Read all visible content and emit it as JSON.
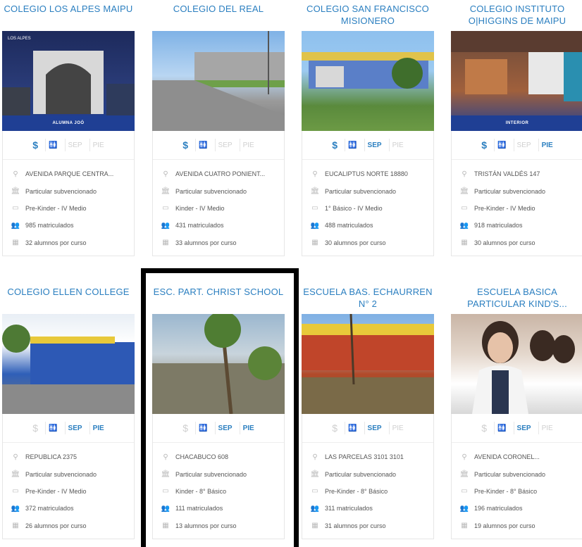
{
  "cards": [
    {
      "title": "COLEGIO LOS ALPES MAIPU",
      "banner": "ALUMNA JOÓ",
      "logo": "LOS ALPES",
      "badges": [
        {
          "label": "$",
          "on": true
        },
        {
          "label": "🚻",
          "on": true
        },
        {
          "label": "SEP",
          "on": false
        },
        {
          "label": "PIE",
          "on": false
        }
      ],
      "address": "AVENIDA PARQUE CENTRA...",
      "type": "Particular subvencionado",
      "levels": "Pre-Kinder - IV Medio",
      "enrolled": "985 matriculados",
      "per_course": "32 alumnos por curso"
    },
    {
      "title": "COLEGIO DEL REAL",
      "banner": "",
      "logo": "",
      "badges": [
        {
          "label": "$",
          "on": true
        },
        {
          "label": "🚻",
          "on": true
        },
        {
          "label": "SEP",
          "on": false
        },
        {
          "label": "PIE",
          "on": false
        }
      ],
      "address": "AVENIDA CUATRO PONIENT...",
      "type": "Particular subvencionado",
      "levels": "Kinder - IV Medio",
      "enrolled": "431 matriculados",
      "per_course": "33 alumnos por curso"
    },
    {
      "title": "COLEGIO SAN FRANCISCO MISIONERO",
      "banner": "",
      "logo": "",
      "badges": [
        {
          "label": "$",
          "on": true
        },
        {
          "label": "🚻",
          "on": true
        },
        {
          "label": "SEP",
          "on": true
        },
        {
          "label": "PIE",
          "on": false
        }
      ],
      "address": "EUCALIPTUS NORTE 18880",
      "type": "Particular subvencionado",
      "levels": "1° Básico - IV Medio",
      "enrolled": "488 matriculados",
      "per_course": "30 alumnos por curso"
    },
    {
      "title": "COLEGIO INSTITUTO O|HIGGINS DE MAIPU",
      "banner": "INTERIOR",
      "logo": "",
      "badges": [
        {
          "label": "$",
          "on": true
        },
        {
          "label": "🚻",
          "on": true
        },
        {
          "label": "SEP",
          "on": false
        },
        {
          "label": "PIE",
          "on": true
        }
      ],
      "address": "TRISTÁN VALDÉS 147",
      "type": "Particular subvencionado",
      "levels": "Pre-Kinder - IV Medio",
      "enrolled": "918 matriculados",
      "per_course": "30 alumnos por curso"
    },
    {
      "title": "COLEGIO ELLEN COLLEGE",
      "banner": "",
      "logo": "",
      "badges": [
        {
          "label": "$",
          "on": false
        },
        {
          "label": "🚻",
          "on": true
        },
        {
          "label": "SEP",
          "on": true
        },
        {
          "label": "PIE",
          "on": true
        }
      ],
      "address": "REPUBLICA 2375",
      "type": "Particular subvencionado",
      "levels": "Pre-Kinder - IV Medio",
      "enrolled": "372 matriculados",
      "per_course": "26 alumnos por curso"
    },
    {
      "title": "ESC. PART. CHRIST SCHOOL",
      "banner": "",
      "logo": "",
      "badges": [
        {
          "label": "$",
          "on": false
        },
        {
          "label": "🚻",
          "on": true
        },
        {
          "label": "SEP",
          "on": true
        },
        {
          "label": "PIE",
          "on": true
        }
      ],
      "address": "CHACABUCO 608",
      "type": "Particular subvencionado",
      "levels": "Kinder - 8° Básico",
      "enrolled": "111 matriculados",
      "per_course": "13 alumnos por curso"
    },
    {
      "title": "ESCUELA BAS. ECHAURREN N° 2",
      "banner": "",
      "logo": "",
      "badges": [
        {
          "label": "$",
          "on": false
        },
        {
          "label": "🚻",
          "on": true
        },
        {
          "label": "SEP",
          "on": true
        },
        {
          "label": "PIE",
          "on": false
        }
      ],
      "address": "LAS PARCELAS 3101 3101",
      "type": "Particular subvencionado",
      "levels": "Pre-Kinder - 8° Básico",
      "enrolled": "311 matriculados",
      "per_course": "31 alumnos por curso"
    },
    {
      "title": "ESCUELA BASICA PARTICULAR KIND'S...",
      "banner": "",
      "logo": "",
      "badges": [
        {
          "label": "$",
          "on": false
        },
        {
          "label": "🚻",
          "on": true
        },
        {
          "label": "SEP",
          "on": true
        },
        {
          "label": "PIE",
          "on": false
        }
      ],
      "address": "AVENIDA CORONEL...",
      "type": "Particular subvencionado",
      "levels": "Pre-Kinder - 8° Básico",
      "enrolled": "196 matriculados",
      "per_course": "19 alumnos por curso"
    }
  ],
  "icons": {
    "address": "location-pin-icon",
    "type": "building-icon",
    "levels": "levels-icon",
    "enrolled": "students-icon",
    "per_course": "classroom-icon"
  }
}
